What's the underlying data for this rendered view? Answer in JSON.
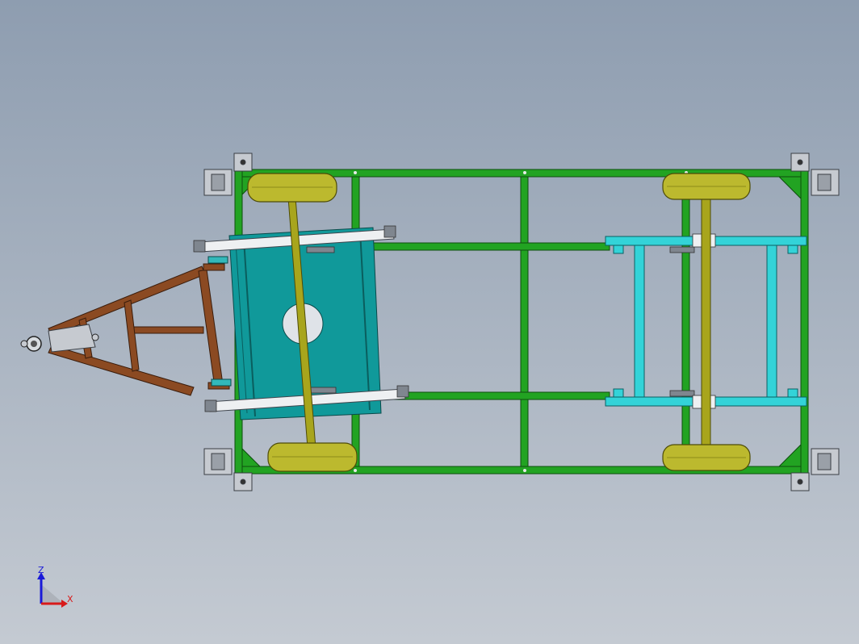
{
  "viewport": {
    "background_top": "#8e9db0",
    "background_bottom": "#c4cad2"
  },
  "model": {
    "frame_color": "#22a322",
    "drawbar_color": "#8b4a22",
    "bogie_plate_color": "#10999a",
    "rear_bogie_color": "#33d3d8",
    "axle_color": "#a8a51c",
    "wheel_color": "#bcb92e",
    "bracket_color": "#c6cad0"
  },
  "triad": {
    "z_label": "Z",
    "x_label": "X",
    "z_color": "#1a1ad8",
    "x_color": "#d81a1a",
    "z_icon": "z-axis-arrow-icon",
    "x_icon": "x-axis-arrow-icon"
  }
}
